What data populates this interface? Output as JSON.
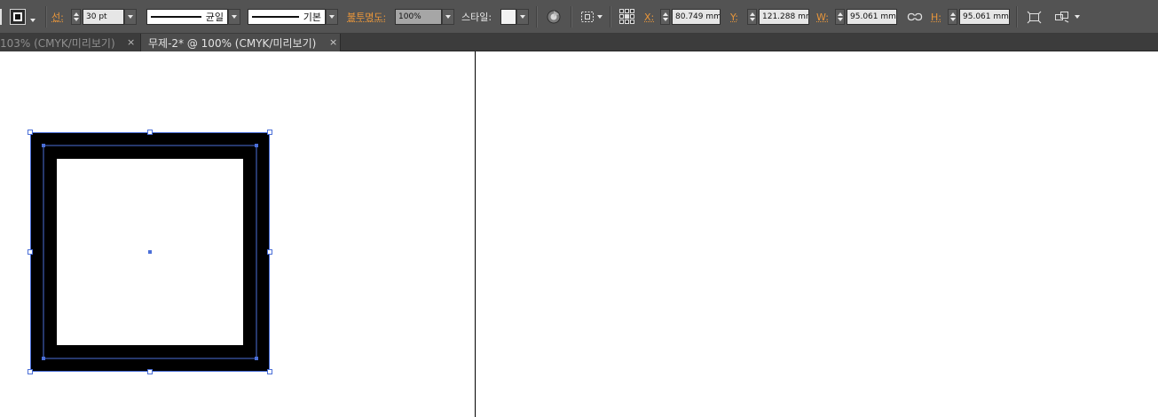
{
  "toolbar": {
    "stroke_label": "선:",
    "stroke_weight": "30 pt",
    "variable_width_profile": "균일",
    "brush_definition": "기본",
    "opacity_label": "불투명도:",
    "opacity_value": "100%",
    "style_label": "스타일:",
    "x_label": "X:",
    "x_value": "80.749 mm",
    "y_label": "Y:",
    "y_value": "121.288 mm",
    "w_label": "W:",
    "w_value": "95.061 mm",
    "h_label": "H:",
    "h_value": "95.061 mm"
  },
  "tabs": [
    {
      "title": "103% (CMYK/미리보기)",
      "close": "×"
    },
    {
      "title": "무제-2* @ 100% (CMYK/미리보기)",
      "close": "×"
    }
  ],
  "colors": {
    "toolbar_bg": "#535353",
    "tab_bar_bg": "#3c3c3c",
    "label_orange": "#e8963a",
    "selection_blue": "#4b6fd8",
    "shape_stroke": "#000000",
    "canvas": "#ffffff"
  },
  "icons": [
    "stroke-color-icon",
    "recolor-artwork-icon",
    "align-to-icon",
    "reference-point-icon",
    "constrain-proportions-icon",
    "transform-icon",
    "isolate-object-icon"
  ]
}
